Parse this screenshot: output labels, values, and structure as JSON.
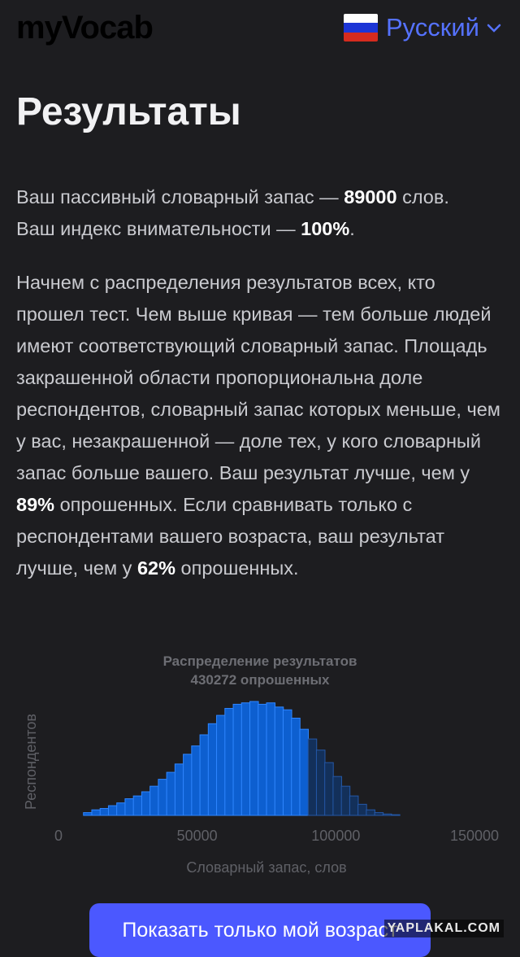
{
  "header": {
    "logo_text": "myVocab",
    "language_label": "Русский",
    "flag_colors": [
      "#ffffff",
      "#1c35d6",
      "#d52b1e"
    ]
  },
  "page_title": "Результаты",
  "summary": {
    "line1_prefix": "Ваш пассивный словарный запас — ",
    "vocab_size": "89000",
    "line1_suffix": " слов.",
    "line2_prefix": "Ваш индекс внимательности — ",
    "attention_index": "100%",
    "line2_suffix": "."
  },
  "description": {
    "text_1": "Начнем с распределения результатов всех, кто прошел тест. Чем выше кривая — тем больше людей имеют соответствующий словарный запас. Площадь закрашенной области пропорциональна доле респондентов, словарный запас которых меньше, чем у вас, незакрашенной — доле тех, у кого словарный запас больше вашего. Ваш результат лучше, чем у ",
    "percent_all": "89%",
    "text_2": " опрошенных. Если сравнивать только с респондентами вашего возраста, ваш результат лучше, чем у ",
    "percent_age": "62%",
    "text_3": " опрошенных."
  },
  "chart_data": {
    "type": "area",
    "title": "Распределение результатов",
    "subtitle": "430272 опрошенных",
    "xlabel": "Словарный запас, слов",
    "ylabel": "Респондентов",
    "xlim": [
      0,
      150000
    ],
    "x_ticks": [
      "0",
      "50000",
      "100000",
      "150000"
    ],
    "user_value": 90000,
    "bin_width": 3000,
    "x": [
      9000,
      12000,
      15000,
      18000,
      21000,
      24000,
      27000,
      30000,
      33000,
      36000,
      39000,
      42000,
      45000,
      48000,
      51000,
      54000,
      57000,
      60000,
      63000,
      66000,
      69000,
      72000,
      75000,
      78000,
      81000,
      84000,
      87000,
      90000,
      93000,
      96000,
      99000,
      102000,
      105000,
      108000,
      111000,
      114000,
      117000,
      120000
    ],
    "values": [
      2,
      4,
      5,
      7,
      9,
      12,
      14,
      17,
      21,
      26,
      31,
      37,
      44,
      50,
      58,
      66,
      72,
      77,
      80,
      81,
      82,
      80,
      81,
      78,
      76,
      70,
      62,
      55,
      47,
      38,
      28,
      21,
      14,
      8,
      4,
      2,
      1,
      0.5
    ],
    "colors": {
      "filled": "#0d5fd0",
      "filled_stroke": "#2f86ff",
      "unfilled": "#13305a",
      "unfilled_stroke": "#2458a8"
    }
  },
  "action_button": {
    "label": "Показать только мой возраст"
  },
  "watermark": "YAPLAKAL.COM"
}
